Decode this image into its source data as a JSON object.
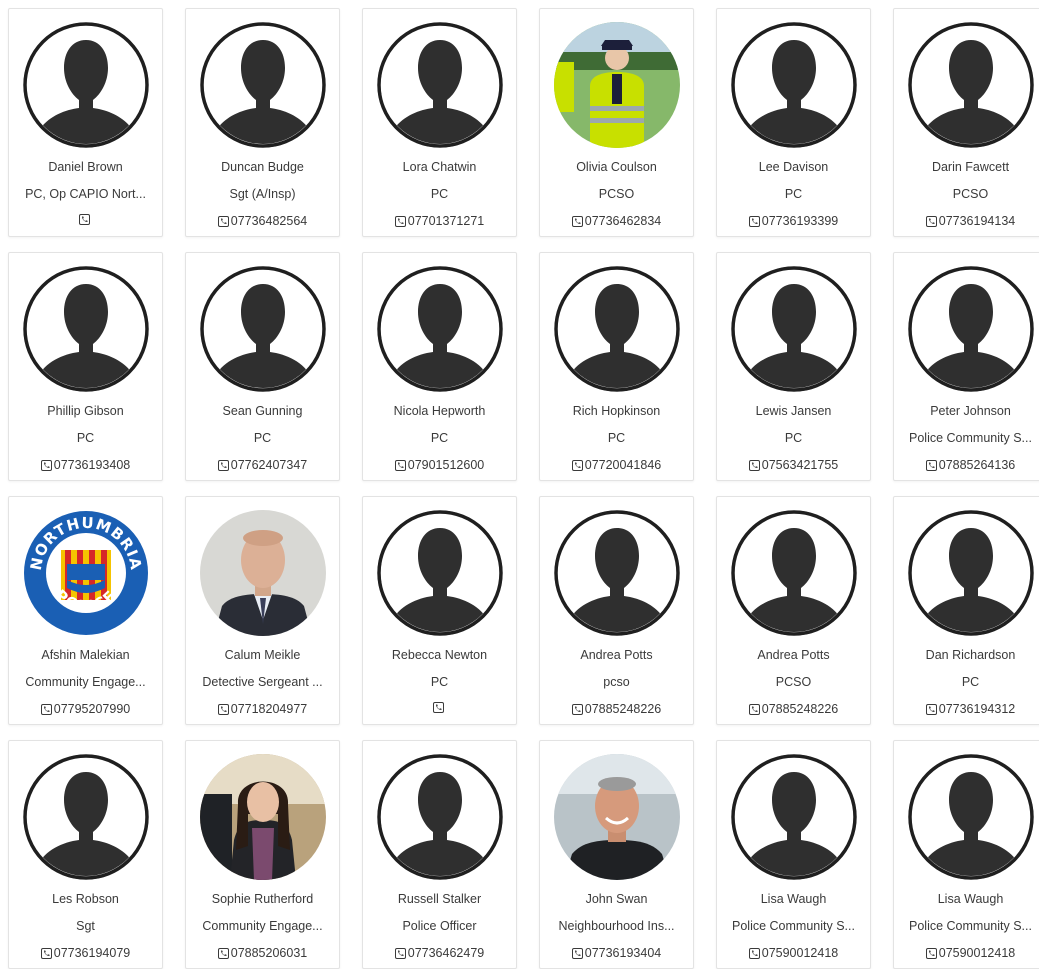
{
  "contacts": [
    {
      "name": "Daniel Brown",
      "role": "PC, Op CAPIO Nort...",
      "phone": "",
      "avatar": "silhouette-icon"
    },
    {
      "name": "Duncan Budge",
      "role": "Sgt (A/Insp)",
      "phone": "07736482564",
      "avatar": "silhouette-icon"
    },
    {
      "name": "Lora Chatwin",
      "role": "PC",
      "phone": "07701371271",
      "avatar": "silhouette-icon"
    },
    {
      "name": "Olivia Coulson",
      "role": "PCSO",
      "phone": "07736462834",
      "avatar": "photo-officer-hivis"
    },
    {
      "name": "Lee Davison",
      "role": "PC",
      "phone": "07736193399",
      "avatar": "silhouette-icon"
    },
    {
      "name": "Darin Fawcett",
      "role": "PCSO",
      "phone": "07736194134",
      "avatar": "silhouette-icon"
    },
    {
      "name": "Phillip Gibson",
      "role": "PC",
      "phone": "07736193408",
      "avatar": "silhouette-icon"
    },
    {
      "name": "Sean Gunning",
      "role": "PC",
      "phone": "07762407347",
      "avatar": "silhouette-icon"
    },
    {
      "name": "Nicola Hepworth",
      "role": "PC",
      "phone": "07901512600",
      "avatar": "silhouette-icon"
    },
    {
      "name": "Rich Hopkinson",
      "role": "PC",
      "phone": "07720041846",
      "avatar": "silhouette-icon"
    },
    {
      "name": "Lewis Jansen",
      "role": "PC",
      "phone": "07563421755",
      "avatar": "silhouette-icon"
    },
    {
      "name": "Peter Johnson",
      "role": "Police Community S...",
      "phone": "07885264136",
      "avatar": "silhouette-icon"
    },
    {
      "name": "Afshin Malekian",
      "role": "Community Engage...",
      "phone": "07795207990",
      "avatar": "northumbria-police-logo",
      "logo_text_top": "NORTHUMBRIA",
      "logo_text_bottom": "POLICE"
    },
    {
      "name": "Calum Meikle",
      "role": "Detective Sergeant ...",
      "phone": "07718204977",
      "avatar": "photo-man-suit"
    },
    {
      "name": "Rebecca Newton",
      "role": "PC",
      "phone": "",
      "avatar": "silhouette-icon"
    },
    {
      "name": "Andrea Potts",
      "role": "pcso",
      "phone": "07885248226",
      "avatar": "silhouette-icon"
    },
    {
      "name": "Andrea Potts",
      "role": "PCSO",
      "phone": "07885248226",
      "avatar": "silhouette-icon"
    },
    {
      "name": "Dan Richardson",
      "role": "PC",
      "phone": "07736194312",
      "avatar": "silhouette-icon"
    },
    {
      "name": "Les Robson",
      "role": "Sgt",
      "phone": "07736194079",
      "avatar": "silhouette-icon"
    },
    {
      "name": "Sophie Rutherford",
      "role": "Community Engage...",
      "phone": "07885206031",
      "avatar": "photo-woman"
    },
    {
      "name": "Russell Stalker",
      "role": "Police Officer",
      "phone": "07736462479",
      "avatar": "silhouette-icon"
    },
    {
      "name": "John Swan",
      "role": "Neighbourhood Ins...",
      "phone": "07736193404",
      "avatar": "photo-man-smiling"
    },
    {
      "name": "Lisa Waugh",
      "role": "Police Community S...",
      "phone": "07590012418",
      "avatar": "silhouette-icon"
    },
    {
      "name": "Lisa Waugh",
      "role": "Police Community S...",
      "phone": "07590012418",
      "avatar": "silhouette-icon"
    }
  ],
  "colors": {
    "text": "#3a3a3a",
    "silhouette": "#2f2f2f",
    "card_border": "#e3e3e3",
    "hivis_yellow": "#c8e000",
    "logo_blue": "#1a5fb4",
    "logo_red": "#d62828",
    "logo_yellow": "#f5c400"
  }
}
